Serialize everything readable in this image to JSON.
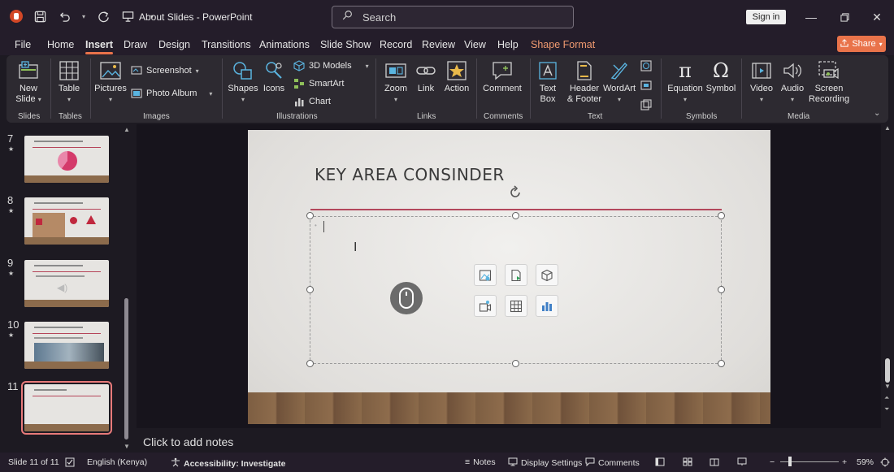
{
  "window": {
    "title": "About Slides  -  PowerPoint",
    "search_placeholder": "Search",
    "signin_label": "Sign in"
  },
  "menu": {
    "tabs": [
      "File",
      "Home",
      "Insert",
      "Draw",
      "Design",
      "Transitions",
      "Animations",
      "Slide Show",
      "Record",
      "Review",
      "View",
      "Help",
      "Shape Format"
    ],
    "active": "Insert",
    "share_label": "Share"
  },
  "ribbon": {
    "slides": {
      "new_slide_l1": "New",
      "new_slide_l2": "Slide",
      "group": "Slides"
    },
    "tables": {
      "table": "Table",
      "group": "Tables"
    },
    "images": {
      "pictures": "Pictures",
      "screenshot": "Screenshot",
      "photo_album": "Photo Album",
      "group": "Images"
    },
    "illustrations": {
      "shapes": "Shapes",
      "icons": "Icons",
      "models": "3D Models",
      "smartart": "SmartArt",
      "chart": "Chart",
      "group": "Illustrations"
    },
    "links": {
      "zoom": "Zoom",
      "link": "Link",
      "action": "Action",
      "group": "Links"
    },
    "comments": {
      "comment": "Comment",
      "group": "Comments"
    },
    "text": {
      "textbox_l1": "Text",
      "textbox_l2": "Box",
      "header_l1": "Header",
      "header_l2": "& Footer",
      "wordart": "WordArt",
      "group": "Text"
    },
    "symbols": {
      "equation": "Equation",
      "symbol": "Symbol",
      "group": "Symbols"
    },
    "media": {
      "video": "Video",
      "audio": "Audio",
      "screen_l1": "Screen",
      "screen_l2": "Recording",
      "group": "Media"
    }
  },
  "slides_panel": {
    "thumbnails": [
      {
        "number": "7"
      },
      {
        "number": "8"
      },
      {
        "number": "9"
      },
      {
        "number": "10"
      },
      {
        "number": "11"
      }
    ]
  },
  "slide": {
    "title": "KEY AREA CONSINDER"
  },
  "notes": {
    "placeholder": "Click to add notes"
  },
  "status": {
    "slide_count": "Slide 11 of 11",
    "language": "English (Kenya)",
    "accessibility": "Accessibility: Investigate",
    "notes": "Notes",
    "display_settings": "Display Settings",
    "comments": "Comments",
    "zoom": "59%"
  },
  "colors": {
    "accent": "#e9734a",
    "title_line": "#b3475c",
    "titlebar_bg": "#241d2a"
  }
}
